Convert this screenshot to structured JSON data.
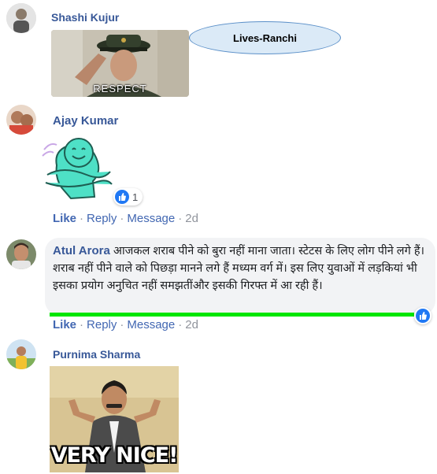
{
  "annotation": {
    "label": "Lives-Ranchi"
  },
  "comments": [
    {
      "author": "Shashi Kujur",
      "gif_caption": "RESPECT"
    },
    {
      "author": "Ajay Kumar",
      "reaction_count": "1",
      "actions": {
        "like": "Like",
        "reply": "Reply",
        "message": "Message",
        "time": "2d"
      }
    },
    {
      "author": "Atul Arora",
      "text": "आजकल शराब पीने को बुरा नहीं माना जाता। स्टेटस के लिए लोग पीने लगे हैं। शराब नहीं पीने वाले को पिछड़ा मानने लगे हैं मध्यम वर्ग में। इस लिए युवाओं में लड़कियां भी इसका प्रयोग अनुचित नहीं समझतींऔर इसकी गिरफ्त में आ रही हैं।",
      "actions": {
        "like": "Like",
        "reply": "Reply",
        "message": "Message",
        "time": "2d"
      }
    },
    {
      "author": "Purnima Sharma",
      "gif_caption": "VERY NICE!"
    }
  ],
  "colors": {
    "link": "#4267b2",
    "author": "#385898",
    "highlight_line": "#00e600",
    "annotation_fill": "#dbeaf7",
    "annotation_border": "#5a8fc8"
  },
  "icons": [
    "thumbs-up-icon",
    "hug-sticker-icon"
  ]
}
